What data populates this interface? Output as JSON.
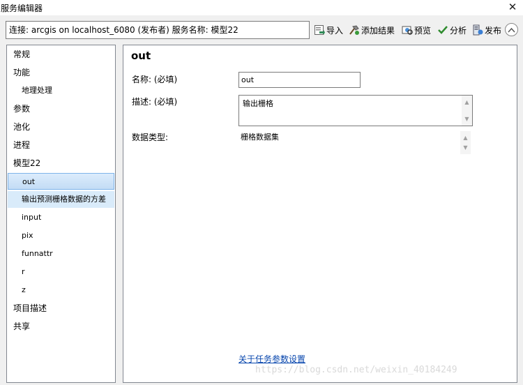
{
  "window": {
    "title": "服务编辑器",
    "close_glyph": "✕"
  },
  "toolbar": {
    "connection_text": "连接: arcgis on localhost_6080 (发布者)   服务名称: 模型22",
    "buttons": [
      {
        "label": "导入",
        "icon": "import-icon"
      },
      {
        "label": "添加结果",
        "icon": "add-result-icon"
      },
      {
        "label": "预览",
        "icon": "preview-icon"
      },
      {
        "label": "分析",
        "icon": "analyze-checkmark-icon"
      },
      {
        "label": "发布",
        "icon": "publish-icon"
      }
    ],
    "collapse_icon": "chevron-up-icon"
  },
  "sidebar": {
    "items": [
      {
        "label": "常规"
      },
      {
        "label": "功能"
      },
      {
        "label": "地理处理"
      },
      {
        "label": "参数"
      },
      {
        "label": "池化"
      },
      {
        "label": "进程"
      },
      {
        "label": "模型22"
      },
      {
        "label": "out"
      },
      {
        "label": "输出预测栅格数据的方差"
      },
      {
        "label": "input"
      },
      {
        "label": "pix"
      },
      {
        "label": "funnattr"
      },
      {
        "label": "r"
      },
      {
        "label": "z"
      },
      {
        "label": "项目描述"
      },
      {
        "label": "共享"
      }
    ],
    "selected": "out"
  },
  "main": {
    "title": "out",
    "name_label": "名称: (必填)",
    "name_value": "out",
    "desc_label": "描述: (必填)",
    "desc_value": "输出栅格",
    "dtype_label": "数据类型:",
    "dtype_value": "栅格数据集",
    "help_link": "关于任务参数设置"
  },
  "watermark": "https://blog.csdn.net/weixin_40184249",
  "colors": {
    "selected_bg": "#cce4f7",
    "link": "#0645ad",
    "border": "#828790"
  }
}
